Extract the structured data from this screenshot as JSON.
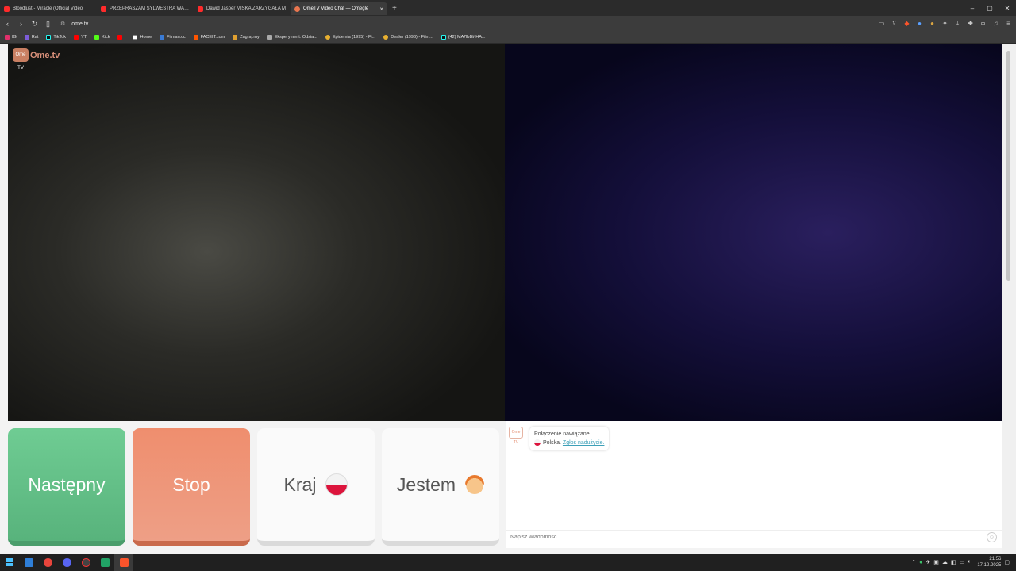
{
  "tabs": [
    {
      "label": "Bloodlust - Miracle (Official Video",
      "icon": "youtube-icon",
      "active": false
    },
    {
      "label": "PRZEPRASZAM SYLWESTRA WARDĘ",
      "icon": "youtube-icon",
      "active": false
    },
    {
      "label": "Dawid Jasper MIŚKA ZARZYGAŁA M",
      "icon": "youtube-icon",
      "active": false
    },
    {
      "label": "OmeTV Video Chat — Omegle",
      "icon": "ometv-icon",
      "active": true
    }
  ],
  "address": {
    "url": "ome.tv"
  },
  "bookmarks": [
    "IG",
    "Rat",
    "TikTok",
    "YT",
    "Kick",
    "",
    "Home",
    "Filman.cc",
    "FACEIT.com",
    "Zagraj.my",
    "Eksperyment: Odsia...",
    "Epidemia (1995) - Fi...",
    "Dealer (1996) - Film...",
    "(42) МАЛЬВИНА..."
  ],
  "logo": {
    "box": "Ome TV",
    "text": "Ome.tv"
  },
  "controls": {
    "next": "Następny",
    "stop": "Stop",
    "country": "Kraj",
    "gender": "Jestem"
  },
  "chat": {
    "logo": "Ome TV",
    "status": "Połączenie nawiązane.",
    "country": "Polska.",
    "report": "Zgłoś nadużycie.",
    "placeholder": "Napisz wiadomość"
  },
  "taskbar": {
    "time": "21:56",
    "date": "17.12.2025"
  },
  "colors": {
    "next": "#5fbd84",
    "stop": "#ef9375",
    "accent": "#e9764f"
  }
}
